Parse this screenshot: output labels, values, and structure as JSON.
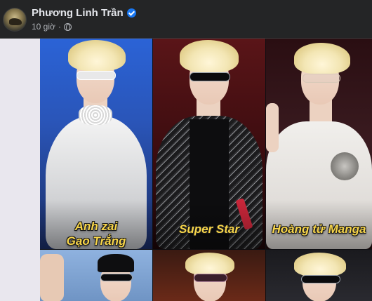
{
  "post": {
    "author": "Phương Linh Trần",
    "time": "10 giờ",
    "verified_icon": "verified-badge-icon",
    "privacy_icon": "globe-icon"
  },
  "captions": {
    "c1_line1": "Anh zai",
    "c1_line2": "Gạo Trắng",
    "c2": "Super Star",
    "c3": "Hoàng tử Manga"
  },
  "colors": {
    "caption_yellow": "#f7d54a",
    "verified_blue": "#1877f2",
    "background": "#242526"
  }
}
